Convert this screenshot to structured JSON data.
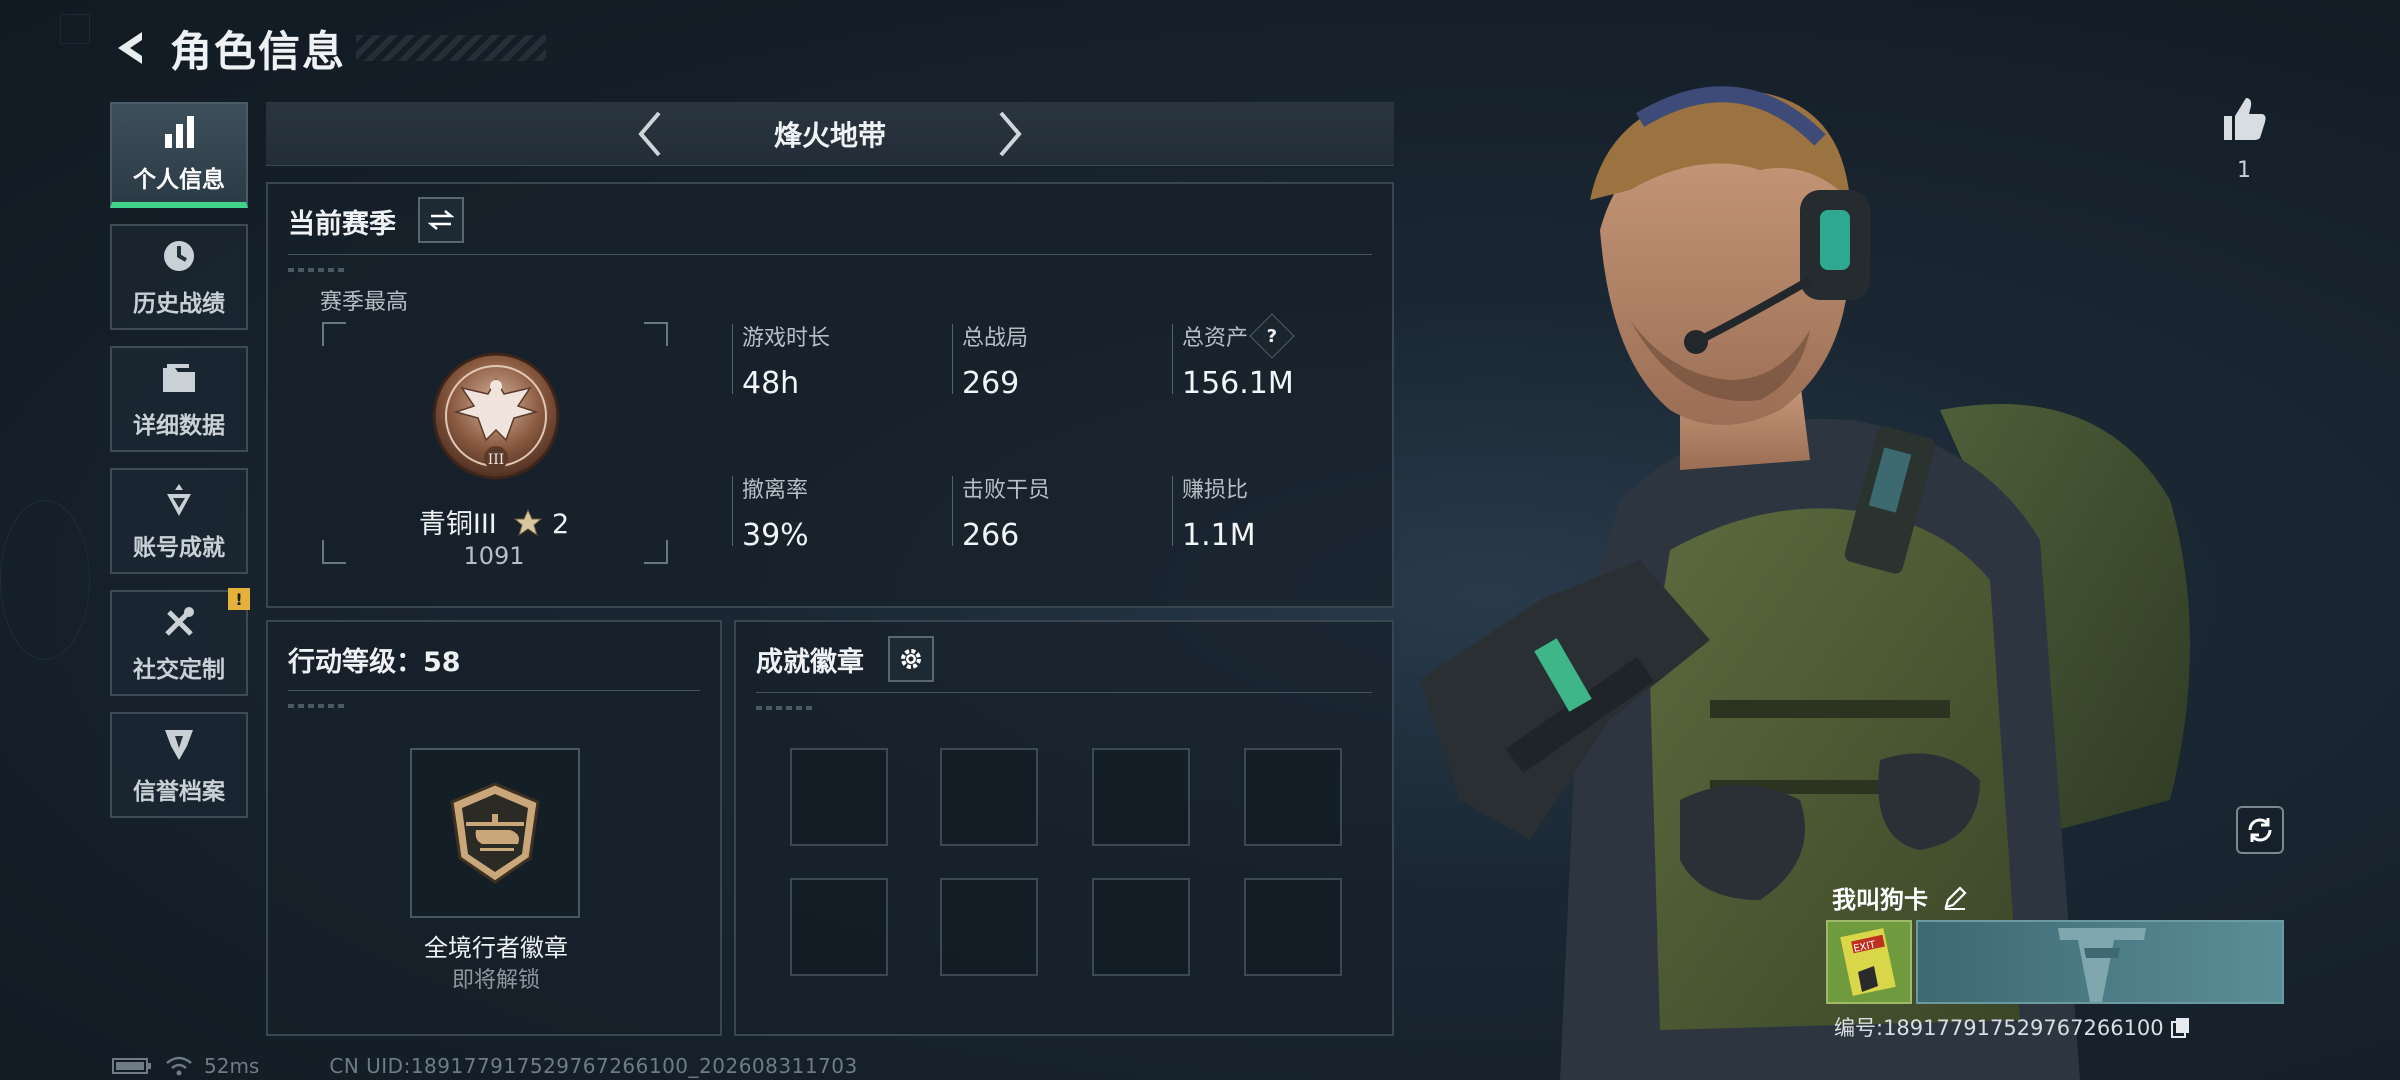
{
  "header": {
    "title": "角色信息"
  },
  "sidebar": {
    "items": [
      {
        "label": "个人信息",
        "icon": "bar-chart-icon",
        "active": true
      },
      {
        "label": "历史战绩",
        "icon": "clock-icon",
        "active": false
      },
      {
        "label": "详细数据",
        "icon": "folder-icon",
        "active": false
      },
      {
        "label": "账号成就",
        "icon": "achievement-icon",
        "active": false
      },
      {
        "label": "社交定制",
        "icon": "tools-icon",
        "active": false,
        "badge": "!"
      },
      {
        "label": "信誉档案",
        "icon": "shield-emblem-icon",
        "active": false
      }
    ]
  },
  "mode": {
    "name": "烽火地带"
  },
  "season": {
    "title": "当前赛季",
    "best_label": "赛季最高",
    "rank_name": "青铜III",
    "rank_stars": "2",
    "rank_points": "1091",
    "rank_emblem_numeral": "III",
    "stats": [
      {
        "label": "游戏时长",
        "value": "48h"
      },
      {
        "label": "总战局",
        "value": "269"
      },
      {
        "label": "总资产",
        "value": "156.1M",
        "help": "?"
      },
      {
        "label": "撤离率",
        "value": "39%"
      },
      {
        "label": "击败干员",
        "value": "266"
      },
      {
        "label": "赚损比",
        "value": "1.1M"
      }
    ]
  },
  "action_level": {
    "title": "行动等级：58",
    "badge_name": "全境行者徽章",
    "badge_status": "即将解锁"
  },
  "achievements": {
    "title": "成就徽章",
    "slot_count": 8
  },
  "profile": {
    "likes": "1",
    "card_name": "我叫狗卡",
    "avatar_text": "EXIT",
    "id_text": "编号:1891779175297672661​00"
  },
  "status": {
    "ping": "52ms",
    "uid": "CN UID:18917791752976726610​0_202608311703"
  },
  "colors": {
    "accent_green": "#3fd48a",
    "alert_yellow": "#e4b23a",
    "bronze": "#8a5a40"
  }
}
